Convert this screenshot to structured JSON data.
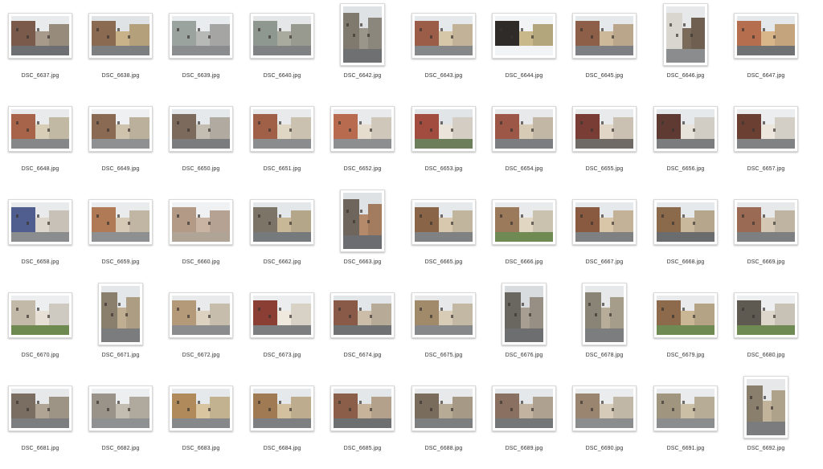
{
  "files": [
    {
      "name": "DSC_6637.jpg",
      "orientation": "landscape",
      "palette": [
        "#e8eaec",
        "#7a5a4a",
        "#a89a8a",
        "#6d6f72"
      ]
    },
    {
      "name": "DSC_6638.jpg",
      "orientation": "landscape",
      "palette": [
        "#dfe3e6",
        "#8a6a50",
        "#c9b28a",
        "#7c7e80"
      ]
    },
    {
      "name": "DSC_6639.jpg",
      "orientation": "landscape",
      "palette": [
        "#e9ecee",
        "#9aa39e",
        "#b7b9b6",
        "#8a8c8e"
      ]
    },
    {
      "name": "DSC_6640.jpg",
      "orientation": "landscape",
      "palette": [
        "#e4e6e8",
        "#8e9891",
        "#a9ab9f",
        "#7f8183"
      ]
    },
    {
      "name": "DSC_6642.jpg",
      "orientation": "portrait",
      "palette": [
        "#dfe2e4",
        "#7f7a6d",
        "#9a968a",
        "#6f7072"
      ]
    },
    {
      "name": "DSC_6643.jpg",
      "orientation": "landscape",
      "palette": [
        "#e6e9eb",
        "#9b5c48",
        "#d7c7a9",
        "#858789"
      ]
    },
    {
      "name": "DSC_6644.jpg",
      "orientation": "landscape",
      "palette": [
        "#f2f3f4",
        "#2e2b28",
        "#c8b88a",
        "#f2f3f4"
      ]
    },
    {
      "name": "DSC_6645.jpg",
      "orientation": "landscape",
      "palette": [
        "#e6e9eb",
        "#8e5f48",
        "#cdb89a",
        "#7d7f82"
      ]
    },
    {
      "name": "DSC_6646.jpg",
      "orientation": "portrait",
      "palette": [
        "#e6e8ea",
        "#d9d6cf",
        "#7a6a5a",
        "#8a8c8e"
      ]
    },
    {
      "name": "DSC_6647.jpg",
      "orientation": "landscape",
      "palette": [
        "#e5e8ea",
        "#b56f4f",
        "#d9b68a",
        "#6f7173"
      ]
    },
    {
      "name": "DSC_6648.jpg",
      "orientation": "landscape",
      "palette": [
        "#e8eaec",
        "#a8644a",
        "#d8cdb7",
        "#858789"
      ]
    },
    {
      "name": "DSC_6649.jpg",
      "orientation": "landscape",
      "palette": [
        "#eef0f1",
        "#8a6a52",
        "#cfc3ad",
        "#8e9092"
      ]
    },
    {
      "name": "DSC_6650.jpg",
      "orientation": "landscape",
      "palette": [
        "#e6e9eb",
        "#7c6a5c",
        "#c3bdb2",
        "#7a7c7e"
      ]
    },
    {
      "name": "DSC_6651.jpg",
      "orientation": "landscape",
      "palette": [
        "#e8eaec",
        "#a06048",
        "#e0d6c4",
        "#8a8c8e"
      ]
    },
    {
      "name": "DSC_6652.jpg",
      "orientation": "landscape",
      "palette": [
        "#e8eaec",
        "#b86b4e",
        "#e6ddce",
        "#8c8e90"
      ]
    },
    {
      "name": "DSC_6653.jpg",
      "orientation": "landscape",
      "palette": [
        "#e2e5e7",
        "#a24b3f",
        "#eae4da",
        "#6d7f5a"
      ]
    },
    {
      "name": "DSC_6654.jpg",
      "orientation": "landscape",
      "palette": [
        "#e7e9eb",
        "#9c5746",
        "#d8cbb6",
        "#7b7d80"
      ]
    },
    {
      "name": "DSC_6655.jpg",
      "orientation": "landscape",
      "palette": [
        "#e8eaec",
        "#7a3d35",
        "#e2d6c6",
        "#6f6a66"
      ]
    },
    {
      "name": "DSC_6656.jpg",
      "orientation": "landscape",
      "palette": [
        "#e6e9eb",
        "#5e3a32",
        "#e8e3da",
        "#7a7c7e"
      ]
    },
    {
      "name": "DSC_6657.jpg",
      "orientation": "landscape",
      "palette": [
        "#ecedee",
        "#6b4033",
        "#ece6dc",
        "#808284"
      ]
    },
    {
      "name": "DSC_6658.jpg",
      "orientation": "landscape",
      "palette": [
        "#e8eaec",
        "#4f5e8f",
        "#ddd6cc",
        "#8a8c8e"
      ]
    },
    {
      "name": "DSC_6659.jpg",
      "orientation": "landscape",
      "palette": [
        "#e9ebed",
        "#b07a57",
        "#d6c9b6",
        "#8d8f91"
      ]
    },
    {
      "name": "DSC_6660.jpg",
      "orientation": "landscape",
      "palette": [
        "#f0f1f2",
        "#b39a86",
        "#c9b4a3",
        "#b0a496"
      ]
    },
    {
      "name": "DSC_6662.jpg",
      "orientation": "landscape",
      "palette": [
        "#e4e7e9",
        "#7b7467",
        "#c8b898",
        "#777a7c"
      ]
    },
    {
      "name": "DSC_6663.jpg",
      "orientation": "portrait",
      "palette": [
        "#dfe2e4",
        "#6e665c",
        "#b58a6a",
        "#6b6d70"
      ]
    },
    {
      "name": "DSC_6665.jpg",
      "orientation": "landscape",
      "palette": [
        "#e6e9eb",
        "#8a6446",
        "#d8c9ae",
        "#7f8183"
      ]
    },
    {
      "name": "DSC_6666.jpg",
      "orientation": "landscape",
      "palette": [
        "#e8eaec",
        "#9a7a5a",
        "#e0d6c2",
        "#6f8a52"
      ]
    },
    {
      "name": "DSC_6667.jpg",
      "orientation": "landscape",
      "palette": [
        "#e6e9eb",
        "#8a5a40",
        "#d9c6a8",
        "#7e8082"
      ]
    },
    {
      "name": "DSC_6668.jpg",
      "orientation": "landscape",
      "palette": [
        "#e6e9eb",
        "#8a6a4a",
        "#c9b89c",
        "#6a6c6e"
      ]
    },
    {
      "name": "DSC_6669.jpg",
      "orientation": "landscape",
      "palette": [
        "#e6e8ea",
        "#9a6a55",
        "#d4c8b4",
        "#7d7f81"
      ]
    },
    {
      "name": "DSC_6670.jpg",
      "orientation": "landscape",
      "palette": [
        "#eceeef",
        "#c2b9a8",
        "#e6e0d6",
        "#6e8a50"
      ]
    },
    {
      "name": "DSC_6671.jpg",
      "orientation": "portrait",
      "palette": [
        "#e4e7e9",
        "#8a7e6c",
        "#bfae92",
        "#7a7c7e"
      ]
    },
    {
      "name": "DSC_6672.jpg",
      "orientation": "landscape",
      "palette": [
        "#e8eaec",
        "#b49a78",
        "#ddd2c0",
        "#8a8c8e"
      ]
    },
    {
      "name": "DSC_6673.jpg",
      "orientation": "landscape",
      "palette": [
        "#ebedee",
        "#8a3e34",
        "#efe8dc",
        "#7c7e80"
      ]
    },
    {
      "name": "DSC_6674.jpg",
      "orientation": "landscape",
      "palette": [
        "#e3e6e8",
        "#8a5a48",
        "#cbbda8",
        "#6f7173"
      ]
    },
    {
      "name": "DSC_6675.jpg",
      "orientation": "landscape",
      "palette": [
        "#e6e8ea",
        "#a08a6a",
        "#d8ccb6",
        "#868889"
      ]
    },
    {
      "name": "DSC_6676.jpg",
      "orientation": "portrait",
      "palette": [
        "#d9dcde",
        "#6a6660",
        "#a89f92",
        "#6c6e70"
      ]
    },
    {
      "name": "DSC_6678.jpg",
      "orientation": "portrait",
      "palette": [
        "#e6e8ea",
        "#8a8476",
        "#b7ad98",
        "#7b7d7f"
      ]
    },
    {
      "name": "DSC_6679.jpg",
      "orientation": "landscape",
      "palette": [
        "#e8eaec",
        "#8e6a4c",
        "#c8b694",
        "#6f8a52"
      ]
    },
    {
      "name": "DSC_6680.jpg",
      "orientation": "landscape",
      "palette": [
        "#eceeef",
        "#5e5a52",
        "#ddd6ca",
        "#6f8a52"
      ]
    },
    {
      "name": "DSC_6681.jpg",
      "orientation": "landscape",
      "palette": [
        "#e6e8ea",
        "#7a6e62",
        "#b0a594",
        "#7b7d7f"
      ]
    },
    {
      "name": "DSC_6682.jpg",
      "orientation": "landscape",
      "palette": [
        "#eceeef",
        "#9a938a",
        "#c3bcb0",
        "#8e9092"
      ]
    },
    {
      "name": "DSC_6683.jpg",
      "orientation": "landscape",
      "palette": [
        "#e6e9eb",
        "#b08a5a",
        "#d9c6a0",
        "#868889"
      ]
    },
    {
      "name": "DSC_6684.jpg",
      "orientation": "landscape",
      "palette": [
        "#e6e9eb",
        "#a07a52",
        "#d2c09e",
        "#7d7f81"
      ]
    },
    {
      "name": "DSC_6685.jpg",
      "orientation": "landscape",
      "palette": [
        "#e4e7e9",
        "#8a5e48",
        "#c7b39a",
        "#6d6f71"
      ]
    },
    {
      "name": "DSC_6688.jpg",
      "orientation": "landscape",
      "palette": [
        "#e7e9eb",
        "#7a6c5c",
        "#b8ab96",
        "#7c7e80"
      ]
    },
    {
      "name": "DSC_6689.jpg",
      "orientation": "landscape",
      "palette": [
        "#e5e8ea",
        "#8a7060",
        "#c1b3a0",
        "#747678"
      ]
    },
    {
      "name": "DSC_6690.jpg",
      "orientation": "landscape",
      "palette": [
        "#eaecee",
        "#9a8670",
        "#d6cbb8",
        "#8a8c8e"
      ]
    },
    {
      "name": "DSC_6691.jpg",
      "orientation": "landscape",
      "palette": [
        "#e9ebed",
        "#a09680",
        "#cbbfa6",
        "#8a8c8e"
      ]
    },
    {
      "name": "DSC_6692.jpg",
      "orientation": "portrait",
      "palette": [
        "#e6e8ea",
        "#8a7e6c",
        "#c2b49a",
        "#7a7c7e"
      ]
    }
  ]
}
